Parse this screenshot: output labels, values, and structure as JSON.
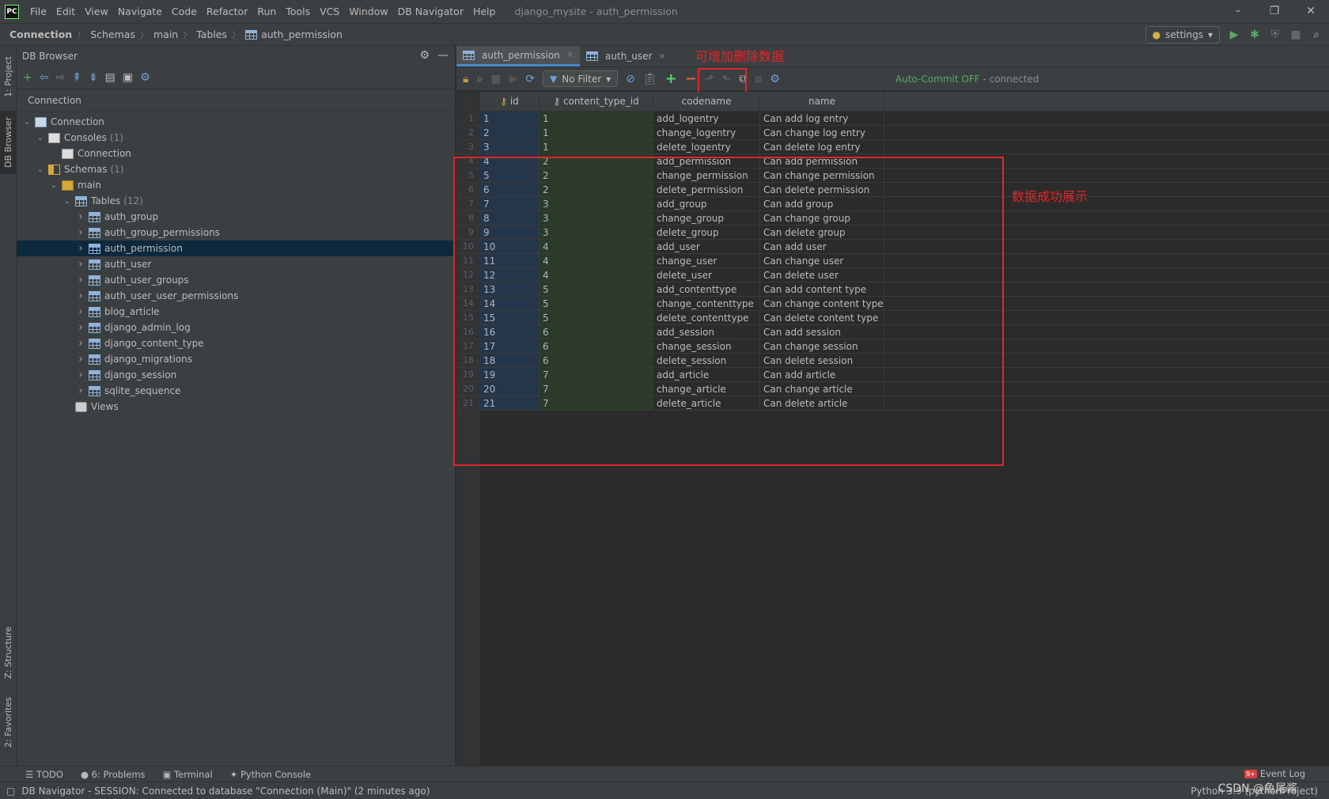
{
  "menu": {
    "logo": "PC",
    "items": [
      "File",
      "Edit",
      "View",
      "Navigate",
      "Code",
      "Refactor",
      "Run",
      "Tools",
      "VCS",
      "Window",
      "DB Navigator",
      "Help"
    ],
    "window_title": "django_mysite - auth_permission"
  },
  "breadcrumb": [
    "Connection",
    "Schemas",
    "main",
    "Tables",
    "auth_permission"
  ],
  "run_config": "settings",
  "left_tabs": {
    "project": "1: Project",
    "db_browser": "DB Browser",
    "structure": "Z: Structure",
    "favorites": "2: Favorites"
  },
  "db_browser": {
    "title": "DB Browser",
    "sub_header": "Connection",
    "tree": [
      {
        "level": 0,
        "arrow": "open",
        "icon": "db",
        "label": "Connection",
        "count": ""
      },
      {
        "level": 1,
        "arrow": "open",
        "icon": "cons",
        "label": "Consoles",
        "count": "(1)"
      },
      {
        "level": 2,
        "arrow": "",
        "icon": "cons",
        "label": "Connection",
        "count": ""
      },
      {
        "level": 1,
        "arrow": "open",
        "icon": "schema",
        "label": "Schemas",
        "count": "(1)"
      },
      {
        "level": 2,
        "arrow": "open",
        "icon": "main",
        "label": "main",
        "count": ""
      },
      {
        "level": 3,
        "arrow": "open",
        "icon": "tbl",
        "label": "Tables",
        "count": "(12)"
      },
      {
        "level": 4,
        "arrow": "closed",
        "icon": "tbl",
        "label": "auth_group",
        "count": ""
      },
      {
        "level": 4,
        "arrow": "closed",
        "icon": "tbl",
        "label": "auth_group_permissions",
        "count": ""
      },
      {
        "level": 4,
        "arrow": "closed",
        "icon": "tbl",
        "label": "auth_permission",
        "count": "",
        "selected": true
      },
      {
        "level": 4,
        "arrow": "closed",
        "icon": "tbl",
        "label": "auth_user",
        "count": ""
      },
      {
        "level": 4,
        "arrow": "closed",
        "icon": "tbl",
        "label": "auth_user_groups",
        "count": ""
      },
      {
        "level": 4,
        "arrow": "closed",
        "icon": "tbl",
        "label": "auth_user_user_permissions",
        "count": ""
      },
      {
        "level": 4,
        "arrow": "closed",
        "icon": "tbl",
        "label": "blog_article",
        "count": ""
      },
      {
        "level": 4,
        "arrow": "closed",
        "icon": "tbl",
        "label": "django_admin_log",
        "count": ""
      },
      {
        "level": 4,
        "arrow": "closed",
        "icon": "tbl",
        "label": "django_content_type",
        "count": ""
      },
      {
        "level": 4,
        "arrow": "closed",
        "icon": "tbl",
        "label": "django_migrations",
        "count": ""
      },
      {
        "level": 4,
        "arrow": "closed",
        "icon": "tbl",
        "label": "django_session",
        "count": ""
      },
      {
        "level": 4,
        "arrow": "closed",
        "icon": "tbl",
        "label": "sqlite_sequence",
        "count": ""
      },
      {
        "level": 3,
        "arrow": "",
        "icon": "views",
        "label": "Views",
        "count": ""
      }
    ]
  },
  "editor": {
    "tabs": [
      {
        "label": "auth_permission",
        "active": true
      },
      {
        "label": "auth_user",
        "active": false
      }
    ],
    "filter_label": "No Filter",
    "autocommit": "Auto-Commit OFF",
    "connection_status": "- connected",
    "columns": [
      "id",
      "content_type_id",
      "codename",
      "name"
    ],
    "rows": [
      [
        "1",
        "1",
        "add_logentry",
        "Can add log entry"
      ],
      [
        "2",
        "1",
        "change_logentry",
        "Can change log entry"
      ],
      [
        "3",
        "1",
        "delete_logentry",
        "Can delete log entry"
      ],
      [
        "4",
        "2",
        "add_permission",
        "Can add permission"
      ],
      [
        "5",
        "2",
        "change_permission",
        "Can change permission"
      ],
      [
        "6",
        "2",
        "delete_permission",
        "Can delete permission"
      ],
      [
        "7",
        "3",
        "add_group",
        "Can add group"
      ],
      [
        "8",
        "3",
        "change_group",
        "Can change group"
      ],
      [
        "9",
        "3",
        "delete_group",
        "Can delete group"
      ],
      [
        "10",
        "4",
        "add_user",
        "Can add user"
      ],
      [
        "11",
        "4",
        "change_user",
        "Can change user"
      ],
      [
        "12",
        "4",
        "delete_user",
        "Can delete user"
      ],
      [
        "13",
        "5",
        "add_contenttype",
        "Can add content type"
      ],
      [
        "14",
        "5",
        "change_contenttype",
        "Can change content type"
      ],
      [
        "15",
        "5",
        "delete_contenttype",
        "Can delete content type"
      ],
      [
        "16",
        "6",
        "add_session",
        "Can add session"
      ],
      [
        "17",
        "6",
        "change_session",
        "Can change session"
      ],
      [
        "18",
        "6",
        "delete_session",
        "Can delete session"
      ],
      [
        "19",
        "7",
        "add_article",
        "Can add article"
      ],
      [
        "20",
        "7",
        "change_article",
        "Can change article"
      ],
      [
        "21",
        "7",
        "delete_article",
        "Can delete article"
      ]
    ]
  },
  "annotations": {
    "add_delete": "可增加删除数据",
    "success": "数据成功展示"
  },
  "bottom_tools": [
    "TODO",
    "6: Problems",
    "Terminal",
    "Python Console"
  ],
  "event_log": "Event Log",
  "status": {
    "message": "DB Navigator - SESSION: Connected to database \"Connection (Main)\" (2 minutes ago)",
    "right": "Python 3.9 (pythonProject)"
  },
  "watermark": "CSDN @鱼尾酱",
  "colors": {
    "annotation": "#e0262a",
    "selection": "#0d293e",
    "accent": "#4a88c7",
    "autocommit": "#59a869"
  }
}
